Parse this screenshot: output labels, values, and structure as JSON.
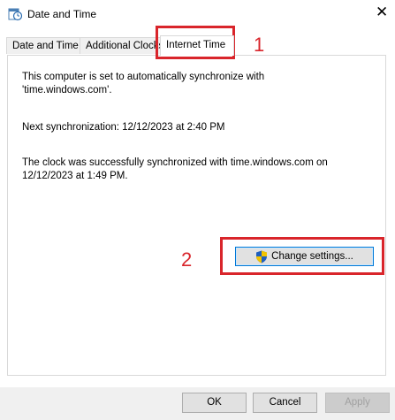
{
  "window": {
    "title": "Date and Time",
    "close_glyph": "✕"
  },
  "tabs": [
    {
      "label": "Date and Time"
    },
    {
      "label": "Additional Clocks"
    },
    {
      "label": "Internet Time"
    }
  ],
  "content": {
    "sync_line1": "This computer is set to automatically synchronize with",
    "sync_line2": "'time.windows.com'.",
    "next_sync": "Next synchronization: 12/12/2023 at 2:40 PM",
    "status_line1": "The clock was successfully synchronized with time.windows.com on",
    "status_line2": "12/12/2023 at 1:49 PM.",
    "change_settings_label": "Change settings..."
  },
  "annotations": {
    "marker1": "1",
    "marker2": "2",
    "color": "#d9252b"
  },
  "footer": {
    "ok_label": "OK",
    "cancel_label": "Cancel",
    "apply_label": "Apply"
  },
  "icons": {
    "app": "date-time-icon",
    "shield": "uac-shield-icon"
  }
}
